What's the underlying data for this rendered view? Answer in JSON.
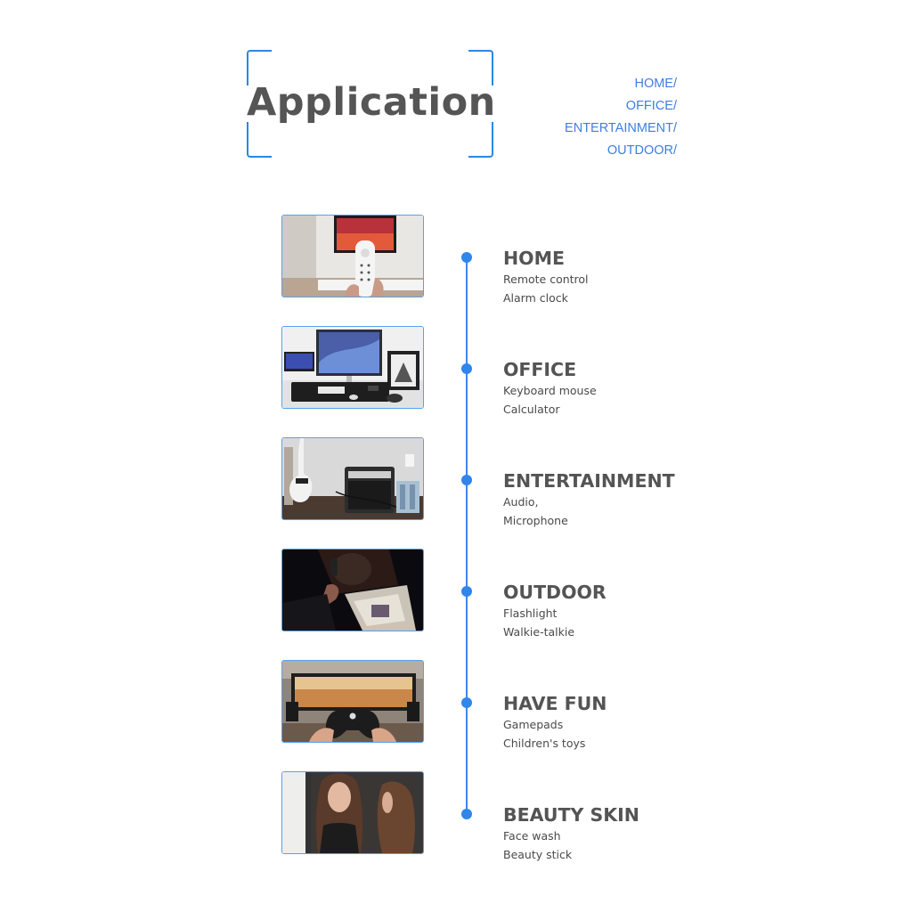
{
  "header": {
    "title": "Application",
    "nav": [
      "HOME/",
      "OFFICE/",
      "ENTERTAINMENT/",
      "OUTDOOR/"
    ]
  },
  "colors": {
    "accent": "#2f86ec",
    "title": "#555555",
    "text": "#4a4a4a",
    "nav": "#3d7fe0"
  },
  "sections": [
    {
      "title": "HOME",
      "items": [
        "Remote control",
        "Alarm clock"
      ],
      "photo": "tv-remote-photo"
    },
    {
      "title": "OFFICE",
      "items": [
        "Keyboard mouse",
        "Calculator"
      ],
      "photo": "desk-setup-photo"
    },
    {
      "title": "ENTERTAINMENT",
      "items": [
        "Audio,",
        "Microphone"
      ],
      "photo": "guitar-amp-photo"
    },
    {
      "title": "OUTDOOR",
      "items": [
        "Flashlight",
        "Walkie-talkie"
      ],
      "photo": "flashlight-reading-photo"
    },
    {
      "title": "HAVE FUN",
      "items": [
        "Gamepads",
        "Children's toys"
      ],
      "photo": "gamepad-photo"
    },
    {
      "title": "BEAUTY SKIN",
      "items": [
        "Face wash",
        "Beauty stick"
      ],
      "photo": "makeup-mirror-photo"
    }
  ]
}
